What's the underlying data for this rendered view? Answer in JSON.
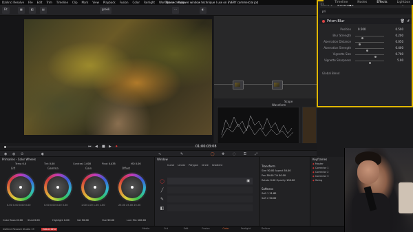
{
  "menubar": {
    "app": "DaVinci Resolve",
    "items": [
      "File",
      "Edit",
      "Trim",
      "Timeline",
      "Clip",
      "Mark",
      "View",
      "Playback",
      "Fusion",
      "Color",
      "Fairlight",
      "Workspace",
      "Help"
    ],
    "title": "The secret power window technique I use on EVERY commercial job"
  },
  "effects": {
    "tabs": [
      "Library",
      "Settings"
    ],
    "active_tab": "Settings",
    "search": "pri",
    "fx_name": "Prism Blur",
    "params": [
      {
        "label": "Position",
        "value": "0.500",
        "value2": "0.500",
        "pos": 0.5
      },
      {
        "label": "Blur Strength",
        "value": "0.200",
        "pos": 0.22
      },
      {
        "label": "Aberration Distance",
        "value": "0.050",
        "pos": 0.12
      },
      {
        "label": "Aberration Strength",
        "value": "0.400",
        "pos": 0.4
      },
      {
        "label": "Vignette Size",
        "value": "0.700",
        "pos": 0.7
      },
      {
        "label": "Vignette Sharpness",
        "value": "5.00",
        "pos": 0.5
      }
    ],
    "global_blend": "Global Blend",
    "right_tabs": [
      "Timeline",
      "Nodes",
      "Effects",
      "Lightbox"
    ]
  },
  "viewer": {
    "fit": "Fit",
    "clip": "greek",
    "timecode": "01:00:03:08"
  },
  "scopes": {
    "title": "Waveform",
    "label": "Scope"
  },
  "primaries": {
    "title": "Primaries - Color Wheels",
    "wheels": [
      {
        "label": "Lift",
        "vals": "0.00  0.00  0.00  0.00"
      },
      {
        "label": "Gamma",
        "vals": "0.00  0.00  0.00  0.00"
      },
      {
        "label": "Gain",
        "vals": "1.00  1.00  1.00  1.00"
      },
      {
        "label": "Offset",
        "vals": "25.00  25.00  25.00"
      }
    ],
    "bottom_labels": [
      "Color Boost",
      "Shad",
      "Highlight",
      "Sat",
      "Hue",
      "Lum Mix"
    ],
    "bottom_values": [
      "0.00",
      "0.00",
      "0.00",
      "50.00",
      "50.00",
      "100.00"
    ],
    "top_labels": [
      "Temp",
      "Tint",
      "Contrast",
      "Pivot",
      "MD"
    ],
    "top_values": [
      "0.0",
      "0.00",
      "1.000",
      "0.435",
      "0.00"
    ]
  },
  "window_panel": {
    "title": "Window",
    "tools": [
      "Curve",
      "Linear",
      "Polygon",
      "Circle",
      "Gradient"
    ],
    "transform_title": "Transform",
    "transform_rows": [
      {
        "a": "Size",
        "av": "50.00",
        "b": "Aspect",
        "bv": "50.00"
      },
      {
        "a": "Pan",
        "av": "50.00",
        "b": "Tilt",
        "bv": "50.00"
      },
      {
        "a": "Rotate",
        "av": "0.00",
        "b": "Opacity",
        "bv": "100.00"
      }
    ],
    "softness_title": "Softness",
    "softness_rows": [
      {
        "a": "Soft 1",
        "av": "11.80"
      },
      {
        "a": "Soft 2",
        "av": "50.00"
      }
    ]
  },
  "keyframes": {
    "title": "Keyframes",
    "rows": [
      "Master",
      "Corrector 1",
      "Corrector 2",
      "Corrector 3",
      "Sizing"
    ]
  },
  "pagebar": {
    "app_label": "DaVinci Resolve Studio 19",
    "badge": "PUBLIC BETA",
    "pages": [
      "Media",
      "Cut",
      "Edit",
      "Fusion",
      "Color",
      "Fairlight",
      "Deliver"
    ],
    "active": "Color"
  }
}
